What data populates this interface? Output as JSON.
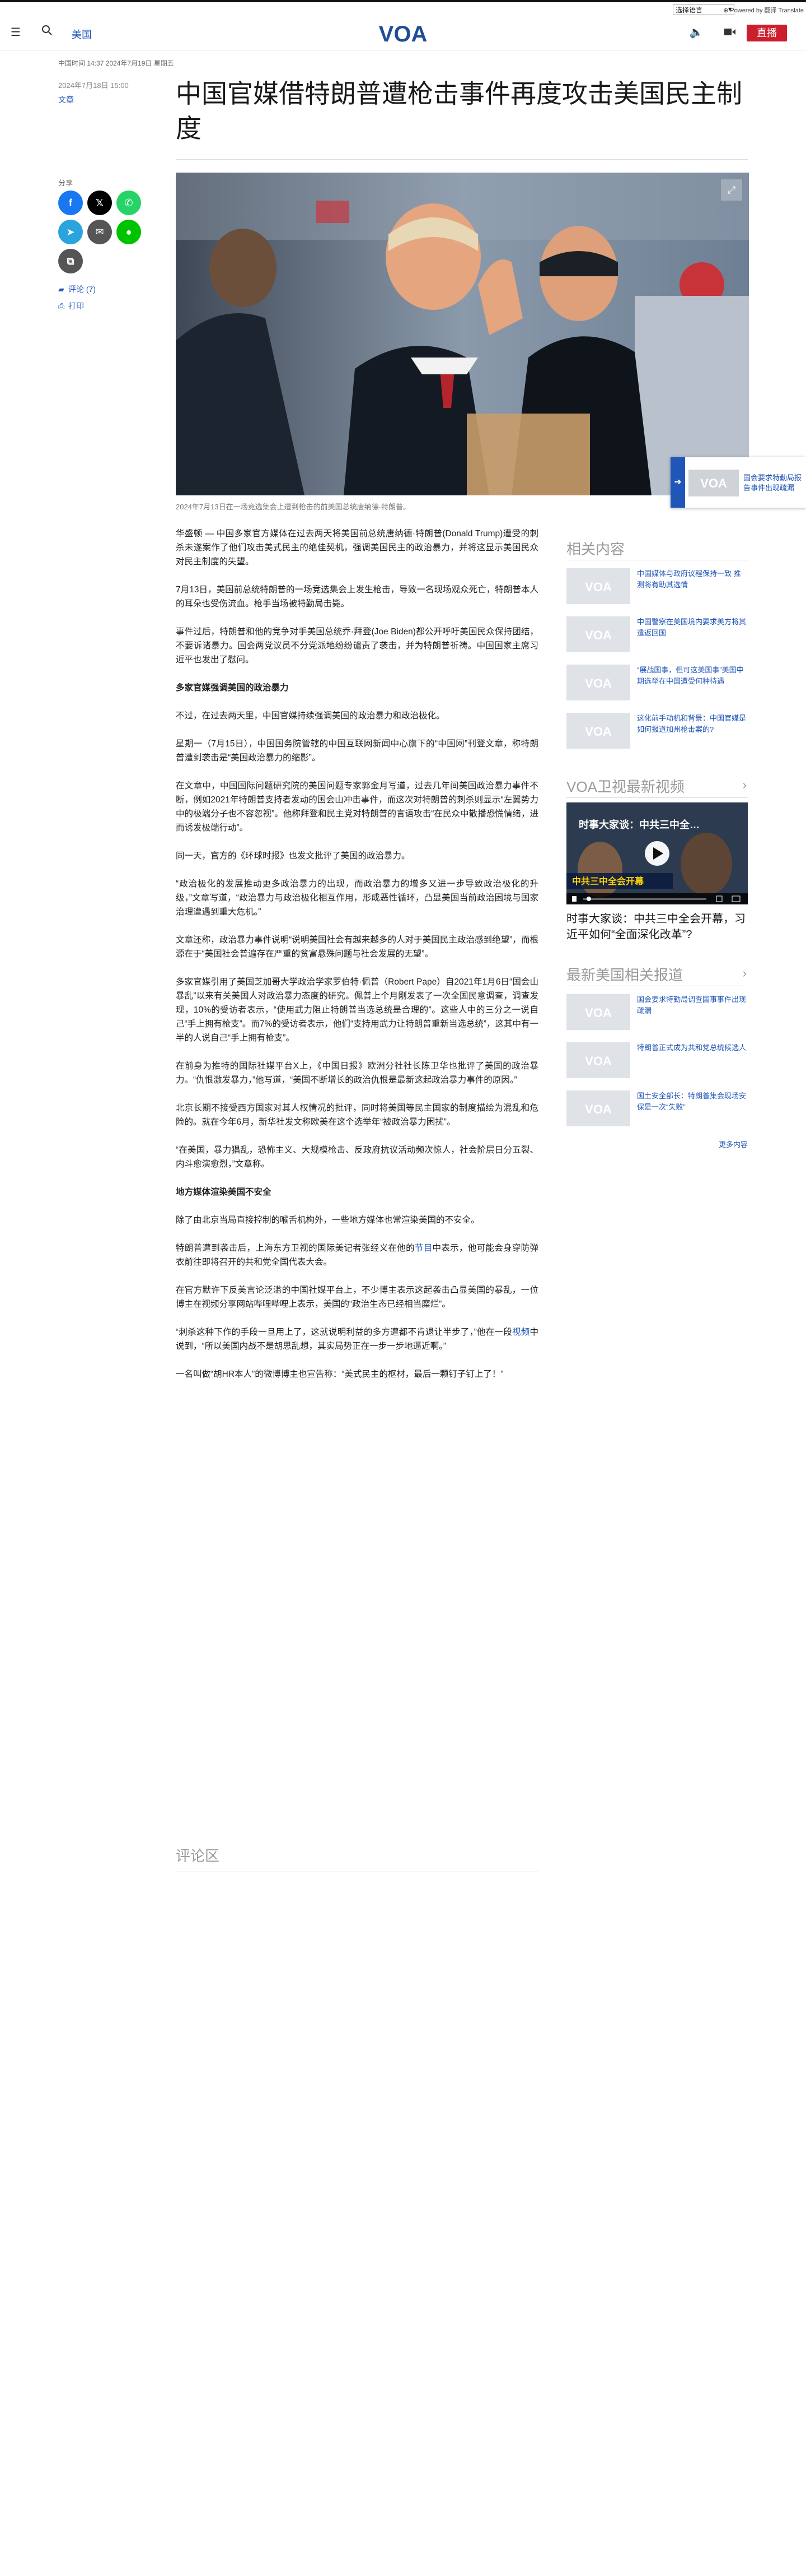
{
  "topbar": {
    "lang_select": "选择语言",
    "lang_links": "⊕ Powered by 翻译 Translate"
  },
  "header": {
    "section": "美国",
    "live": "直播",
    "logo_text": "VOA"
  },
  "article": {
    "meta_line": "中国时间 14:37 2024年7月19日 星期五",
    "date": "2024年7月18日 15:00",
    "author": "文章",
    "title": "中国官媒借特朗普遭枪击事件再度攻击美国民主制度",
    "caption": "2024年7月13日在一场竞选集会上遭到枪击的前美国总统唐纳德·特朗普。",
    "paragraphs": [
      {
        "text": "华盛顿 — 中国多家官方媒体在过去两天将美国前总统唐纳德·特朗普(Donald Trump)遭受的刺杀未遂案作了他们攻击美式民主的绝佳契机，强调美国民主的政治暴力，并将这显示美国民众对民主制度的失望。"
      },
      {
        "text": "7月13日，美国前总统特朗普的一场竞选集会上发生枪击，导致一名现场观众死亡，特朗普本人的耳朵也受伤流血。枪手当场被特勤局击毙。"
      },
      {
        "text": "事件过后，特朗普和他的竞争对手美国总统乔·拜登(Joe Biden)都公开呼吁美国民众保持团结，不要诉诸暴力。国会两党议员不分党派地纷纷谴责了袭击，并为特朗普祈祷。中国国家主席习近平也发出了慰问。"
      },
      {
        "text": "多家官媒强调美国的政治暴力",
        "subhead": true
      },
      {
        "text": "不过，在过去两天里，中国官媒持续强调美国的政治暴力和政治极化。"
      },
      {
        "text": "星期一（7月15日），中国国务院管辖的中国互联网新闻中心旗下的“中国网”刊登文章，称特朗普遭到袭击是“美国政治暴力的缩影”。"
      },
      {
        "text": "在文章中，中国国际问题研究院的美国问题专家郭金月写道，过去几年间美国政治暴力事件不断，例如2021年特朗普支持者发动的国会山冲击事件，而这次对特朗普的刺杀则显示“左翼势力中的极端分子也不容忽视”。他称拜登和民主党对特朗普的言语攻击“在民众中散播恐慌情绪，进而诱发极端行动”。"
      },
      {
        "text": "同一天，官方的《环球时报》也发文批评了美国的政治暴力。"
      },
      {
        "text": "“政治极化的发展推动更多政治暴力的出现，而政治暴力的增多又进一步导致政治极化的升级，”文章写道，“政治暴力与政治极化相互作用，形成恶性循环，凸显美国当前政治困境与国家治理遭遇到重大危机。”"
      },
      {
        "text": "文章还称，政治暴力事件说明“说明美国社会有越来越多的人对于美国民主政治感到绝望”，而根源在于“美国社会普遍存在严重的贫富悬殊问题与社会发展的无望”。"
      },
      {
        "text": "多家官媒引用了美国芝加哥大学政治学家罗伯特·佩普（Robert Pape）自2021年1月6日“国会山暴乱”以来有关美国人对政治暴力态度的研究。佩普上个月刚发表了一次全国民意调查，调查发现，10%的受访者表示，“使用武力阻止特朗普当选总统是合理的”。这些人中的三分之一说自己“手上拥有枪支”。而7%的受访者表示，他们“支持用武力让特朗普重新当选总统”，这其中有一半的人说自己“手上拥有枪支”。"
      },
      {
        "text": "在前身为推特的国际社媒平台X上，《中国日报》欧洲分社社长陈卫华也批评了美国的政治暴力。“仇恨激发暴力，”他写道，“美国不断增长的政治仇恨是最新这起政治暴力事件的原因。”"
      },
      {
        "text": "北京长期不接受西方国家对其人权情况的批评，同时将美国等民主国家的制度描绘为混乱和危险的。就在今年6月，新华社发文称欧美在这个选举年“被政治暴力困扰”。"
      },
      {
        "text": "“在美国，暴力猖乱，恐怖主义、大规模枪击、反政府抗议活动频次惊人，社会阶层日分五裂、内斗愈演愈烈，”文章称。"
      },
      {
        "text": "地方媒体渲染美国不安全",
        "subhead": true
      },
      {
        "text": "除了由北京当局直接控制的喉舌机构外，一些地方媒体也常渲染美国的不安全。"
      },
      {
        "text": "特朗普遭到袭击后，上海东方卫视的国际美记者张经义在他的",
        "link": "节目",
        "tail": "中表示，他可能会身穿防弹衣前往即将召开的共和党全国代表大会。"
      },
      {
        "text": "在官方默许下反美言论泛滥的中国社媒平台上，不少博主表示这起袭击凸显美国的暴乱，一位博主在视频分享网站哔哩哔哩上表示，美国的“政治生态已经相当糜烂”。"
      },
      {
        "text": "“刺杀这种下作的手段一旦用上了，这就说明利益的多方遭都不肯退让半步了，”他在一段",
        "link": "视频",
        "tail": "中说到，“所以美国内战不是胡思乱想，其实局势正在一步一步地逼近啊。”"
      },
      {
        "text": "一名叫做“胡HR本人”的微博博主也宣告称：“美式民主的枢材，最后一颗钉子钉上了！”"
      }
    ],
    "comments_head": "评论区"
  },
  "share": {
    "label": "分享",
    "comments": "评论 (7)",
    "print": "打印"
  },
  "float": {
    "text": "国会要求特勤局报告事件出现疏漏"
  },
  "related": {
    "heading": "相关内容",
    "items": [
      {
        "text": "中国媒体与政府议程保持一致 推测将有助其选情"
      },
      {
        "text": "中国警察在美国境内要求美方将其遣返回国"
      },
      {
        "text": "“展战国事，但可这美国事”美国中期选举在中国遭受何种待遇"
      },
      {
        "text": "这化前手动机和背景：中国官媒是如何报道加州枪击案的?"
      }
    ]
  },
  "video": {
    "heading": "VOA卫视最新视频",
    "overlay_title": "时事大家谈：中共三中全…",
    "overlay_sub": "中共三中全会开幕",
    "title": "时事大家谈：中共三中全会开幕，习近平如何“全面深化改革”?"
  },
  "latest": {
    "heading": "最新美国相关报道",
    "items": [
      {
        "text": "国会要求特勤局调查国事事件出现疏漏"
      },
      {
        "text": "特朗普正式成为共和党总统候选人"
      },
      {
        "text": "国土安全部长：特朗普集会现场安保是一次“失败”"
      }
    ],
    "more": "更多内容"
  }
}
